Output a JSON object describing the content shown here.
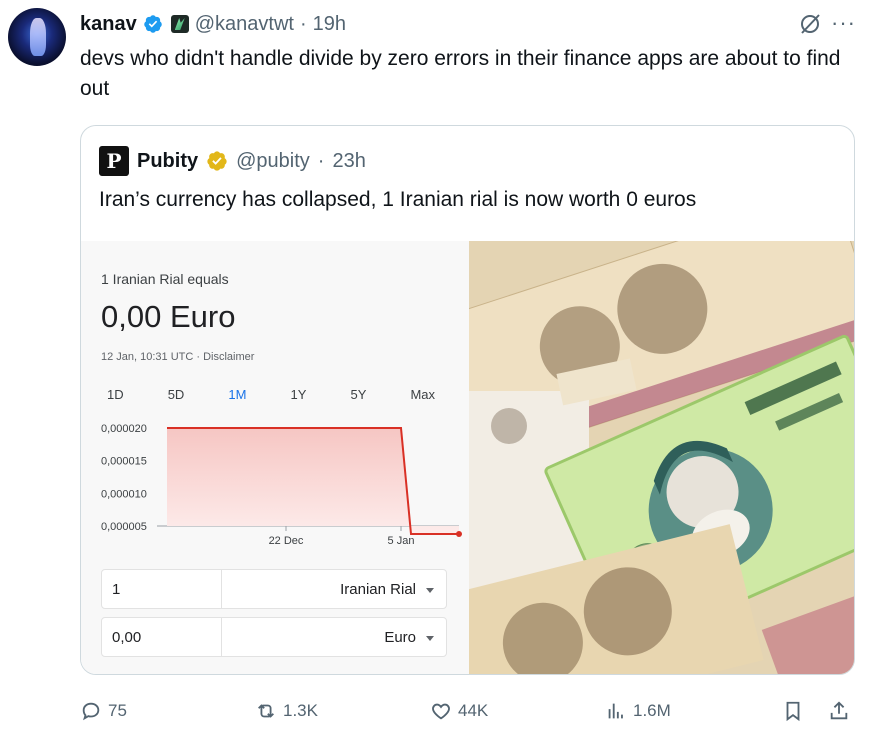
{
  "tweet": {
    "author_name": "kanav",
    "handle": "@kanavtwt",
    "separator": "·",
    "time": "19h",
    "text": "devs who didn't handle divide by zero errors in their finance apps are about to find out"
  },
  "quote": {
    "logo_letter": "P",
    "author_name": "Pubity",
    "handle": "@pubity",
    "separator": "·",
    "time": "23h",
    "text": "Iran’s currency has collapsed, 1 Iranian rial is now worth 0 euros",
    "converter": {
      "label": "1 Iranian Rial equals",
      "value": "0,00 Euro",
      "timestamp": "12 Jan, 10:31 UTC · Disclaimer",
      "ranges": [
        "1D",
        "5D",
        "1M",
        "1Y",
        "5Y",
        "Max"
      ],
      "active_range": "1M",
      "from_amount": "1",
      "from_currency": "Iranian Rial",
      "to_amount": "0,00",
      "to_currency": "Euro"
    }
  },
  "chart_data": {
    "type": "area",
    "title": "",
    "xlabel": "",
    "ylabel": "",
    "y_ticks": [
      "0,000020",
      "0,000015",
      "0,000010",
      "0,000005"
    ],
    "y_tick_values": [
      2e-05,
      1.5e-05,
      1e-05,
      5e-06
    ],
    "x_ticks": [
      "22 Dec",
      "5 Jan"
    ],
    "ylim": [
      5e-06,
      2e-05
    ],
    "series": [
      {
        "x": [
          "13 Dec",
          "22 Dec",
          "5 Jan",
          "7 Jan",
          "12 Jan"
        ],
        "values": [
          2e-05,
          2e-05,
          2e-05,
          5e-07,
          5e-07
        ]
      }
    ],
    "line_color": "#d93025",
    "fill_color": "#f6c6c3",
    "grid": false
  },
  "metrics": {
    "replies": "75",
    "reposts": "1.3K",
    "likes": "44K",
    "views": "1.6M"
  },
  "colors": {
    "verified_blue": "#1d9bf0",
    "verified_gold": "#e2b719",
    "muted": "#536471",
    "active_range": "#1a73e8"
  },
  "icons": {
    "reply": "reply-icon",
    "repost": "repost-icon",
    "like": "like-icon",
    "views": "views-icon",
    "bookmark": "bookmark-icon",
    "share": "share-icon"
  }
}
